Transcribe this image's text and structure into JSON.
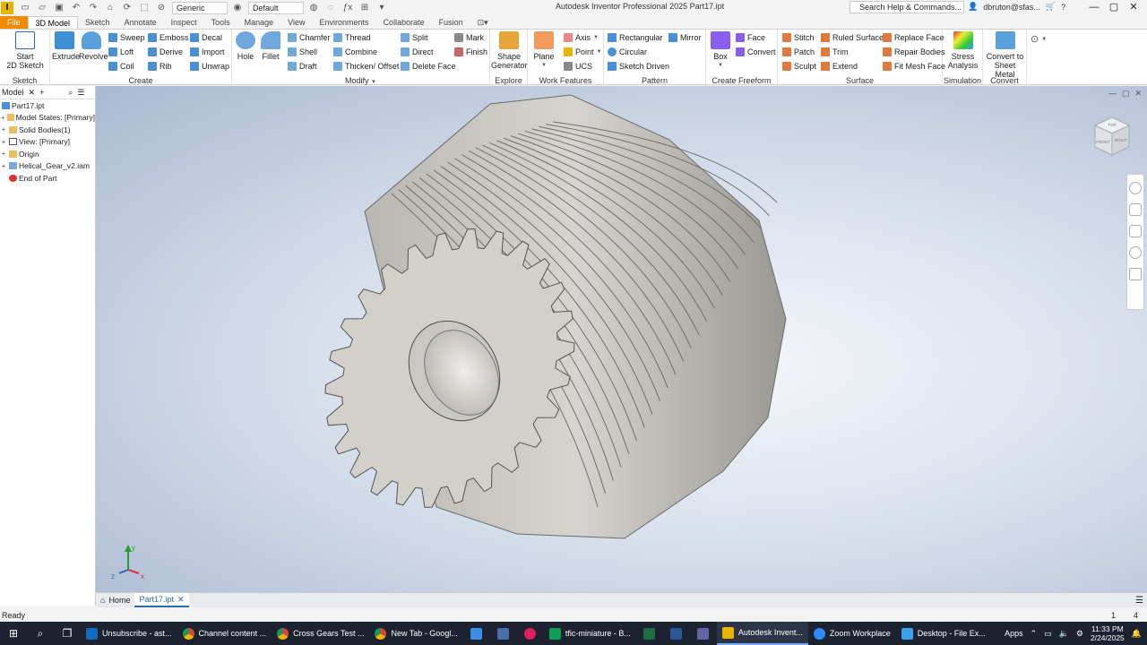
{
  "titlebar": {
    "app_logo_letter": "I",
    "material": "Generic",
    "appearance": "Default",
    "title": "Autodesk Inventor Professional 2025    Part17.ipt",
    "search": "Search Help & Commands...",
    "user": "dbruton@sfas..."
  },
  "tabs": [
    "File",
    "3D Model",
    "Sketch",
    "Annotate",
    "Inspect",
    "Tools",
    "Manage",
    "View",
    "Environments",
    "Collaborate",
    "Fusion"
  ],
  "ribbon": {
    "sketch": {
      "title": "Sketch",
      "start": "Start",
      "start2": "2D Sketch"
    },
    "create": {
      "title": "Create",
      "extrude": "Extrude",
      "revolve": "Revolve",
      "sweep": "Sweep",
      "loft": "Loft",
      "coil": "Coil",
      "emboss": "Emboss",
      "derive": "Derive",
      "rib": "Rib",
      "decal": "Decal",
      "import": "Import",
      "unwrap": "Unwrap"
    },
    "modify": {
      "title": "Modify",
      "hole": "Hole",
      "fillet": "Fillet",
      "chamfer": "Chamfer",
      "shell": "Shell",
      "draft": "Draft",
      "thread": "Thread",
      "combine": "Combine",
      "thicken": "Thicken/ Offset",
      "split": "Split",
      "direct": "Direct",
      "delete_face": "Delete Face",
      "mark": "Mark",
      "finish": "Finish"
    },
    "explore": {
      "title": "Explore",
      "shape1": "Shape",
      "shape2": "Generator"
    },
    "work": {
      "title": "Work Features",
      "plane": "Plane",
      "axis": "Axis",
      "point": "Point",
      "ucs": "UCS"
    },
    "pattern": {
      "title": "Pattern",
      "rect": "Rectangular",
      "circ": "Circular",
      "sketch_driven": "Sketch Driven",
      "mirror": "Mirror"
    },
    "freeform": {
      "title": "Create Freeform",
      "box": "Box",
      "face": "Face",
      "convert": "Convert"
    },
    "surface": {
      "title": "Surface",
      "stitch": "Stitch",
      "patch": "Patch",
      "sculpt": "Sculpt",
      "ruled": "Ruled Surface",
      "trim": "Trim",
      "extend": "Extend",
      "replace": "Replace Face",
      "repair": "Repair Bodies",
      "fitmesh": "Fit Mesh Face"
    },
    "simulation": {
      "title": "Simulation",
      "l1": "Stress",
      "l2": "Analysis"
    },
    "convert": {
      "title": "Convert",
      "l1": "Convert to",
      "l2": "Sheet Metal"
    }
  },
  "browser": {
    "tab": "Model",
    "items": [
      {
        "label": "Part17.ipt"
      },
      {
        "label": "Model States: [Primary]"
      },
      {
        "label": "Solid Bodies(1)"
      },
      {
        "label": "View: [Primary]"
      },
      {
        "label": "Origin"
      },
      {
        "label": "Helical_Gear_v2.iam"
      },
      {
        "label": "End of Part"
      }
    ]
  },
  "viewcube": {
    "front": "FRONT",
    "right": "RIGHT",
    "top": "TOP"
  },
  "doctabs": {
    "home": "Home",
    "active": "Part17.ipt"
  },
  "status": {
    "text": "Ready",
    "n1": "1",
    "n2": "4"
  },
  "taskbar": {
    "apps": [
      "Unsubscribe - ast...",
      "Channel content ...",
      "Cross Gears Test ...",
      "New Tab - Googl...",
      "tfic-miniature - B...",
      "Autodesk Invent...",
      "Zoom Workplace",
      "Desktop - File Ex..."
    ],
    "tray_apps": "Apps",
    "time": "11:33 PM",
    "date": "2/24/2025"
  },
  "colors": {
    "accent": "#f08b00",
    "selection": "#2a6bb0",
    "taskbar": "#1c2230"
  }
}
